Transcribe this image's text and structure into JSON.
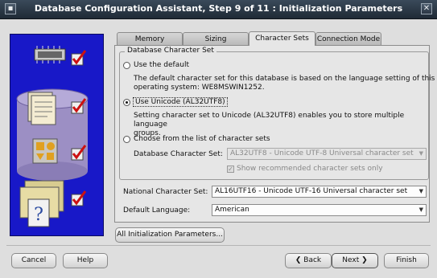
{
  "window": {
    "title": "Database Configuration Assistant, Step 9 of 11 : Initialization Parameters",
    "menu_glyph": "▪",
    "close_glyph": "✕"
  },
  "tabs": [
    {
      "label": "Memory",
      "active": false
    },
    {
      "label": "Sizing",
      "active": false
    },
    {
      "label": "Character Sets",
      "active": true
    },
    {
      "label": "Connection Mode",
      "active": false
    }
  ],
  "charset_group": {
    "title": "Database Character Set",
    "options": [
      {
        "label": "Use the default",
        "selected": false,
        "description": [
          "The default character set for this database is based on the language setting of this",
          "operating system: WE8MSWIN1252."
        ]
      },
      {
        "label": "Use Unicode (AL32UTF8)",
        "selected": true,
        "description": [
          "Setting character set to Unicode (AL32UTF8) enables you to store multiple language",
          "groups."
        ]
      },
      {
        "label": "Choose from the list of character sets",
        "selected": false
      }
    ],
    "db_charset_label": "Database Character Set:",
    "db_charset_value": "AL32UTF8 - Unicode UTF-8 Universal character set",
    "show_recommended_label": "Show recommended character sets only",
    "show_recommended_checked": true
  },
  "national_charset": {
    "label": "National Character Set:",
    "value": "AL16UTF16 - Unicode UTF-16 Universal character set"
  },
  "default_language": {
    "label": "Default Language:",
    "value": "American"
  },
  "buttons": {
    "all_params": "All Initialization Parameters...",
    "cancel": "Cancel",
    "help": "Help",
    "back": "Back",
    "next": "Next",
    "finish": "Finish",
    "back_arrow": "❮",
    "next_arrow": "❯"
  },
  "colors": {
    "art_panel": "#1818c8",
    "checkmark": "#cc1111"
  }
}
